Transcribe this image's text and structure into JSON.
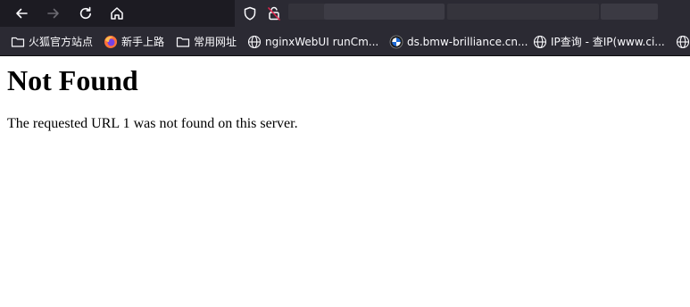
{
  "browser": {
    "nav": {
      "back_icon": "arrow-left-icon",
      "forward_icon": "arrow-right-icon",
      "reload_icon": "reload-icon",
      "home_icon": "home-icon"
    },
    "urlbar": {
      "tracking_protection_icon": "shield-icon",
      "connection_icon": "insecure-lock-icon"
    },
    "bookmarks": [
      {
        "label": "火狐官方站点",
        "icon": "folder-icon"
      },
      {
        "label": "新手上路",
        "icon": "firefox-icon"
      },
      {
        "label": "常用网址",
        "icon": "folder-icon"
      },
      {
        "label": "nginxWebUI runCm...",
        "icon": "globe-icon"
      },
      {
        "label": "ds.bmw-brilliance.cn...",
        "icon": "bmw-icon"
      },
      {
        "label": "IP查询 - 查IP(www.ci...",
        "icon": "globe-icon"
      },
      {
        "label": "",
        "icon": "globe-icon"
      }
    ],
    "colors": {
      "toolbar_bg": "#1c1b22",
      "urlbar_bg": "#2b2a33",
      "bookmarks_bg": "#2b2a33",
      "text_light": "#fbfbfe"
    }
  },
  "page": {
    "heading": "Not Found",
    "message": "The requested URL 1 was not found on this server."
  }
}
